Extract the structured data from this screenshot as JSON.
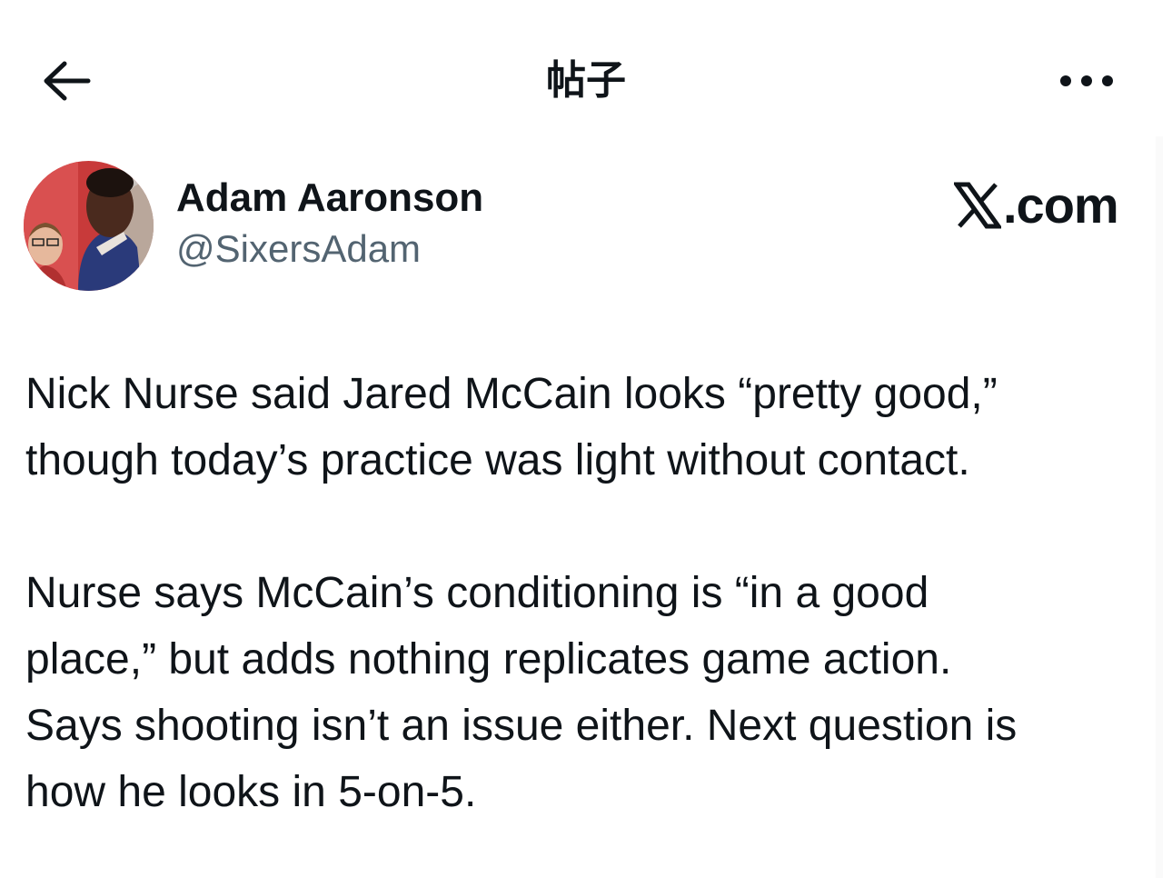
{
  "header": {
    "title": "帖子"
  },
  "post": {
    "author": {
      "display_name": "Adam Aaronson",
      "handle": "@SixersAdam"
    },
    "brand": {
      "text": ".com"
    },
    "body_paragraph_1": [
      "Nick Nurse said Jared McCain looks “pretty good,”",
      "though today’s practice was light without contact."
    ],
    "body_paragraph_2": [
      "Nurse says McCain’s conditioning is “in a good",
      "place,” but adds nothing replicates game action.",
      "Says shooting isn’t an issue either. Next question is",
      "how he looks in 5-on-5."
    ]
  },
  "icons": {
    "back": "arrow-left-icon",
    "more": "more-horizontal-icon",
    "brand": "x-logo-icon"
  }
}
